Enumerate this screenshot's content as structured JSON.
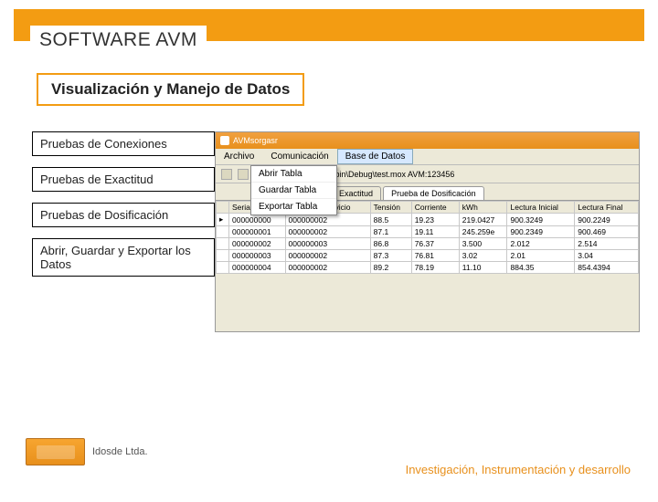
{
  "header": {
    "title": "SOFTWARE AVM"
  },
  "subtitle": "Visualización y Manejo de Datos",
  "sidebar": {
    "items": [
      "Pruebas de Conexiones",
      "Pruebas de Exactitud",
      "Pruebas de Dosificación",
      "Abrir, Guardar y Exportar los Datos"
    ]
  },
  "app": {
    "titlebar": "AVMsorgasr",
    "menu": [
      "Archivo",
      "Comunicación",
      "Base de Datos"
    ],
    "dropdown": [
      "Abrir Tabla",
      "Guardar Tabla",
      "Exportar Tabla"
    ],
    "pathlabel": "\\bin\\Debug\\test.mox AVM:123456",
    "tabs": [
      "eba de Exactitud",
      "Prueba de Dosificación"
    ],
    "columns": [
      "",
      "Serial",
      "Orden de Servicio",
      "Tensión",
      "Corriente",
      "kWh",
      "Lectura Inicial",
      "Lectura Final"
    ],
    "rows": [
      [
        "▸",
        "000000000",
        "000000002",
        "88.5",
        "19.23",
        "219.0427",
        "900.3249",
        "900.2249"
      ],
      [
        "",
        "000000001",
        "000000002",
        "87.1",
        "19.11",
        "245.259e",
        "900.2349",
        "900.469"
      ],
      [
        "",
        "000000002",
        "000000003",
        "86.8",
        "76.37",
        "3.500",
        "2.012",
        "2.514"
      ],
      [
        "",
        "000000003",
        "000000002",
        "87.3",
        "76.81",
        "3.02",
        "2.01",
        "3.04"
      ],
      [
        "",
        "000000004",
        "000000002",
        "89.2",
        "78.19",
        "11.10",
        "884.35",
        "854.4394"
      ]
    ]
  },
  "footer": {
    "company": "Idosde Ltda.",
    "tagline": "Investigación, Instrumentación y desarrollo"
  }
}
